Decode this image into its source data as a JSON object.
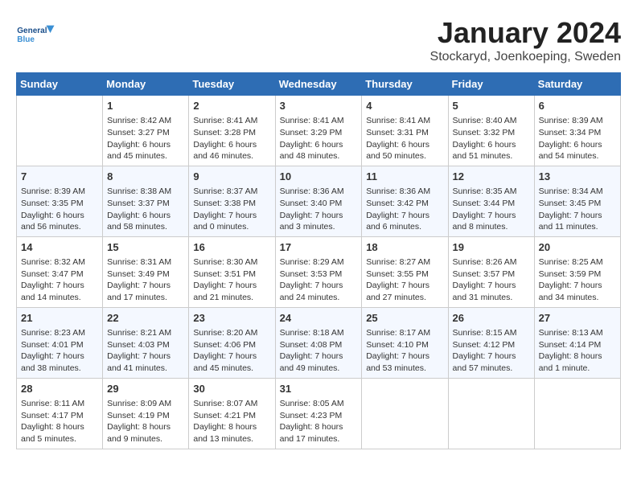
{
  "header": {
    "logo_line1": "General",
    "logo_line2": "Blue",
    "title": "January 2024",
    "subtitle": "Stockaryd, Joenkoeping, Sweden"
  },
  "days_of_week": [
    "Sunday",
    "Monday",
    "Tuesday",
    "Wednesday",
    "Thursday",
    "Friday",
    "Saturday"
  ],
  "weeks": [
    [
      {
        "day": "",
        "content": ""
      },
      {
        "day": "1",
        "content": "Sunrise: 8:42 AM\nSunset: 3:27 PM\nDaylight: 6 hours\nand 45 minutes."
      },
      {
        "day": "2",
        "content": "Sunrise: 8:41 AM\nSunset: 3:28 PM\nDaylight: 6 hours\nand 46 minutes."
      },
      {
        "day": "3",
        "content": "Sunrise: 8:41 AM\nSunset: 3:29 PM\nDaylight: 6 hours\nand 48 minutes."
      },
      {
        "day": "4",
        "content": "Sunrise: 8:41 AM\nSunset: 3:31 PM\nDaylight: 6 hours\nand 50 minutes."
      },
      {
        "day": "5",
        "content": "Sunrise: 8:40 AM\nSunset: 3:32 PM\nDaylight: 6 hours\nand 51 minutes."
      },
      {
        "day": "6",
        "content": "Sunrise: 8:39 AM\nSunset: 3:34 PM\nDaylight: 6 hours\nand 54 minutes."
      }
    ],
    [
      {
        "day": "7",
        "content": "Sunrise: 8:39 AM\nSunset: 3:35 PM\nDaylight: 6 hours\nand 56 minutes."
      },
      {
        "day": "8",
        "content": "Sunrise: 8:38 AM\nSunset: 3:37 PM\nDaylight: 6 hours\nand 58 minutes."
      },
      {
        "day": "9",
        "content": "Sunrise: 8:37 AM\nSunset: 3:38 PM\nDaylight: 7 hours\nand 0 minutes."
      },
      {
        "day": "10",
        "content": "Sunrise: 8:36 AM\nSunset: 3:40 PM\nDaylight: 7 hours\nand 3 minutes."
      },
      {
        "day": "11",
        "content": "Sunrise: 8:36 AM\nSunset: 3:42 PM\nDaylight: 7 hours\nand 6 minutes."
      },
      {
        "day": "12",
        "content": "Sunrise: 8:35 AM\nSunset: 3:44 PM\nDaylight: 7 hours\nand 8 minutes."
      },
      {
        "day": "13",
        "content": "Sunrise: 8:34 AM\nSunset: 3:45 PM\nDaylight: 7 hours\nand 11 minutes."
      }
    ],
    [
      {
        "day": "14",
        "content": "Sunrise: 8:32 AM\nSunset: 3:47 PM\nDaylight: 7 hours\nand 14 minutes."
      },
      {
        "day": "15",
        "content": "Sunrise: 8:31 AM\nSunset: 3:49 PM\nDaylight: 7 hours\nand 17 minutes."
      },
      {
        "day": "16",
        "content": "Sunrise: 8:30 AM\nSunset: 3:51 PM\nDaylight: 7 hours\nand 21 minutes."
      },
      {
        "day": "17",
        "content": "Sunrise: 8:29 AM\nSunset: 3:53 PM\nDaylight: 7 hours\nand 24 minutes."
      },
      {
        "day": "18",
        "content": "Sunrise: 8:27 AM\nSunset: 3:55 PM\nDaylight: 7 hours\nand 27 minutes."
      },
      {
        "day": "19",
        "content": "Sunrise: 8:26 AM\nSunset: 3:57 PM\nDaylight: 7 hours\nand 31 minutes."
      },
      {
        "day": "20",
        "content": "Sunrise: 8:25 AM\nSunset: 3:59 PM\nDaylight: 7 hours\nand 34 minutes."
      }
    ],
    [
      {
        "day": "21",
        "content": "Sunrise: 8:23 AM\nSunset: 4:01 PM\nDaylight: 7 hours\nand 38 minutes."
      },
      {
        "day": "22",
        "content": "Sunrise: 8:21 AM\nSunset: 4:03 PM\nDaylight: 7 hours\nand 41 minutes."
      },
      {
        "day": "23",
        "content": "Sunrise: 8:20 AM\nSunset: 4:06 PM\nDaylight: 7 hours\nand 45 minutes."
      },
      {
        "day": "24",
        "content": "Sunrise: 8:18 AM\nSunset: 4:08 PM\nDaylight: 7 hours\nand 49 minutes."
      },
      {
        "day": "25",
        "content": "Sunrise: 8:17 AM\nSunset: 4:10 PM\nDaylight: 7 hours\nand 53 minutes."
      },
      {
        "day": "26",
        "content": "Sunrise: 8:15 AM\nSunset: 4:12 PM\nDaylight: 7 hours\nand 57 minutes."
      },
      {
        "day": "27",
        "content": "Sunrise: 8:13 AM\nSunset: 4:14 PM\nDaylight: 8 hours\nand 1 minute."
      }
    ],
    [
      {
        "day": "28",
        "content": "Sunrise: 8:11 AM\nSunset: 4:17 PM\nDaylight: 8 hours\nand 5 minutes."
      },
      {
        "day": "29",
        "content": "Sunrise: 8:09 AM\nSunset: 4:19 PM\nDaylight: 8 hours\nand 9 minutes."
      },
      {
        "day": "30",
        "content": "Sunrise: 8:07 AM\nSunset: 4:21 PM\nDaylight: 8 hours\nand 13 minutes."
      },
      {
        "day": "31",
        "content": "Sunrise: 8:05 AM\nSunset: 4:23 PM\nDaylight: 8 hours\nand 17 minutes."
      },
      {
        "day": "",
        "content": ""
      },
      {
        "day": "",
        "content": ""
      },
      {
        "day": "",
        "content": ""
      }
    ]
  ]
}
